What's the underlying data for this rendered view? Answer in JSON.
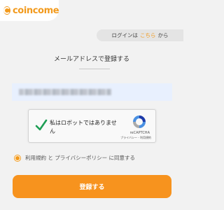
{
  "brand": {
    "logo_text": "coincome",
    "accent_color": "#f29a1d"
  },
  "login_prompt": {
    "prefix": "ログインは",
    "link_text": "こちら",
    "suffix": "から"
  },
  "page": {
    "heading": "メールアドレスで登録する"
  },
  "email_field": {
    "value": ""
  },
  "recaptcha": {
    "checked": true,
    "label": "私はロボットではありません",
    "brand": "reCAPTCHA",
    "terms": "プライバシー - 利用規約"
  },
  "agreement": {
    "checked": true,
    "label": "利用規約 と プライバシーポリシー に同意する"
  },
  "submit": {
    "label": "登録する",
    "color": "#f7931e"
  }
}
